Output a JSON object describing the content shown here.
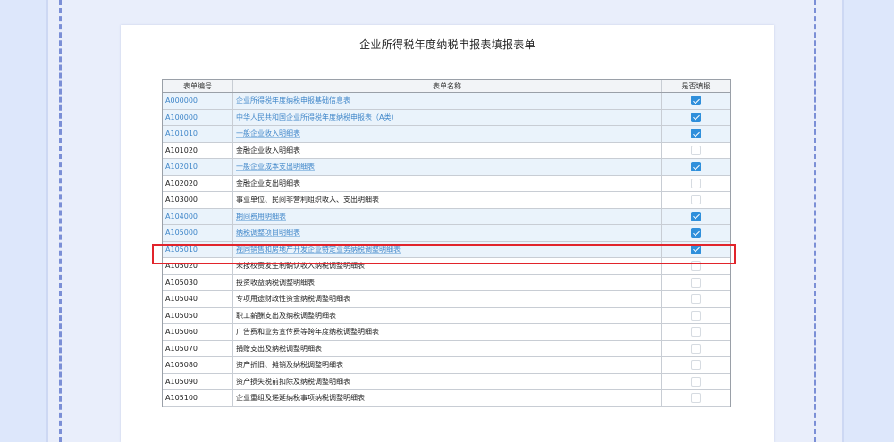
{
  "title": "企业所得税年度纳税申报表填报表单",
  "table": {
    "headers": [
      "表单编号",
      "表单名称",
      "是否填报"
    ],
    "rows": [
      {
        "code": "A000000",
        "name": "企业所得税年度纳税申报基础信息表",
        "checked": true
      },
      {
        "code": "A100000",
        "name": "中华人民共和国企业所得税年度纳税申报表（A类）",
        "checked": true
      },
      {
        "code": "A101010",
        "name": "一般企业收入明细表",
        "checked": true
      },
      {
        "code": "A101020",
        "name": "金融企业收入明细表",
        "checked": false
      },
      {
        "code": "A102010",
        "name": "一般企业成本支出明细表",
        "checked": true
      },
      {
        "code": "A102020",
        "name": "金融企业支出明细表",
        "checked": false
      },
      {
        "code": "A103000",
        "name": "事业单位、民间非营利组织收入、支出明细表",
        "checked": false
      },
      {
        "code": "A104000",
        "name": "期间费用明细表",
        "checked": true
      },
      {
        "code": "A105000",
        "name": "纳税调整项目明细表",
        "checked": true
      },
      {
        "code": "A105010",
        "name": "视同销售和房地产开发企业特定业务纳税调整明细表",
        "checked": true
      },
      {
        "code": "A105020",
        "name": "未按权责发生制确认收入纳税调整明细表",
        "checked": false
      },
      {
        "code": "A105030",
        "name": "投资收益纳税调整明细表",
        "checked": false
      },
      {
        "code": "A105040",
        "name": "专项用途财政性资金纳税调整明细表",
        "checked": false
      },
      {
        "code": "A105050",
        "name": "职工薪酬支出及纳税调整明细表",
        "checked": false
      },
      {
        "code": "A105060",
        "name": "广告费和业务宣传费等跨年度纳税调整明细表",
        "checked": false
      },
      {
        "code": "A105070",
        "name": "捐赠支出及纳税调整明细表",
        "checked": false
      },
      {
        "code": "A105080",
        "name": "资产折旧、摊销及纳税调整明细表",
        "checked": false
      },
      {
        "code": "A105090",
        "name": "资产损失税前扣除及纳税调整明细表",
        "checked": false
      },
      {
        "code": "A105100",
        "name": "企业重组及递延纳税事项纳税调整明细表",
        "checked": false
      }
    ]
  },
  "colors": {
    "accent": "#2f8fdb",
    "highlight": "#e1242b",
    "link_text": "#3f86c9"
  }
}
